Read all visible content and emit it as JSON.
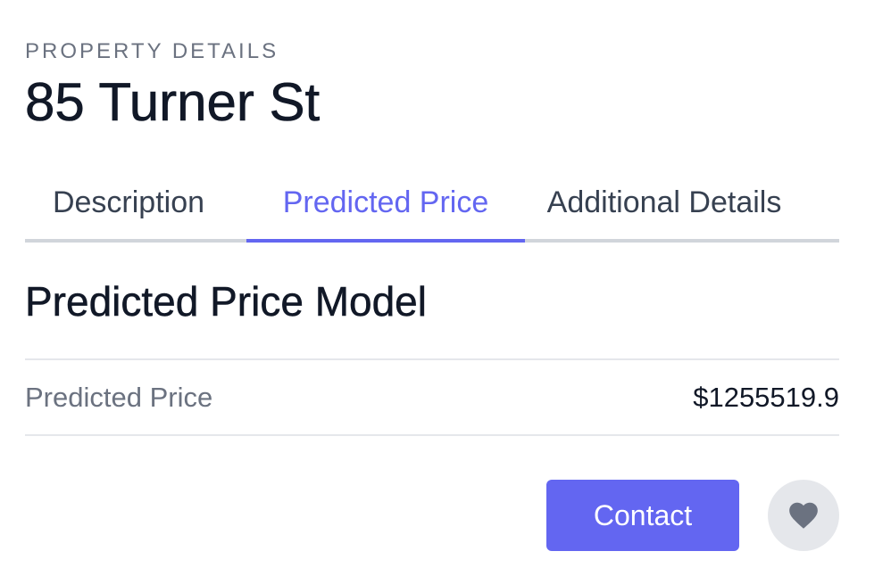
{
  "header": {
    "eyebrow": "PROPERTY DETAILS",
    "title": "85 Turner St"
  },
  "tabs": [
    {
      "label": "Description",
      "active": false
    },
    {
      "label": "Predicted Price",
      "active": true
    },
    {
      "label": "Additional Details",
      "active": false
    }
  ],
  "section": {
    "title": "Predicted Price Model",
    "rows": [
      {
        "label": "Predicted Price",
        "value": "$1255519.9"
      }
    ]
  },
  "actions": {
    "contact_label": "Contact",
    "favorite_icon": "heart-icon"
  },
  "colors": {
    "accent": "#6366f1",
    "text_primary": "#111827",
    "text_muted": "#6b7280",
    "tab_border": "#d1d5db",
    "row_border": "#e5e7eb",
    "icon_button_bg": "#e5e7eb",
    "icon_color": "#6b7280"
  }
}
